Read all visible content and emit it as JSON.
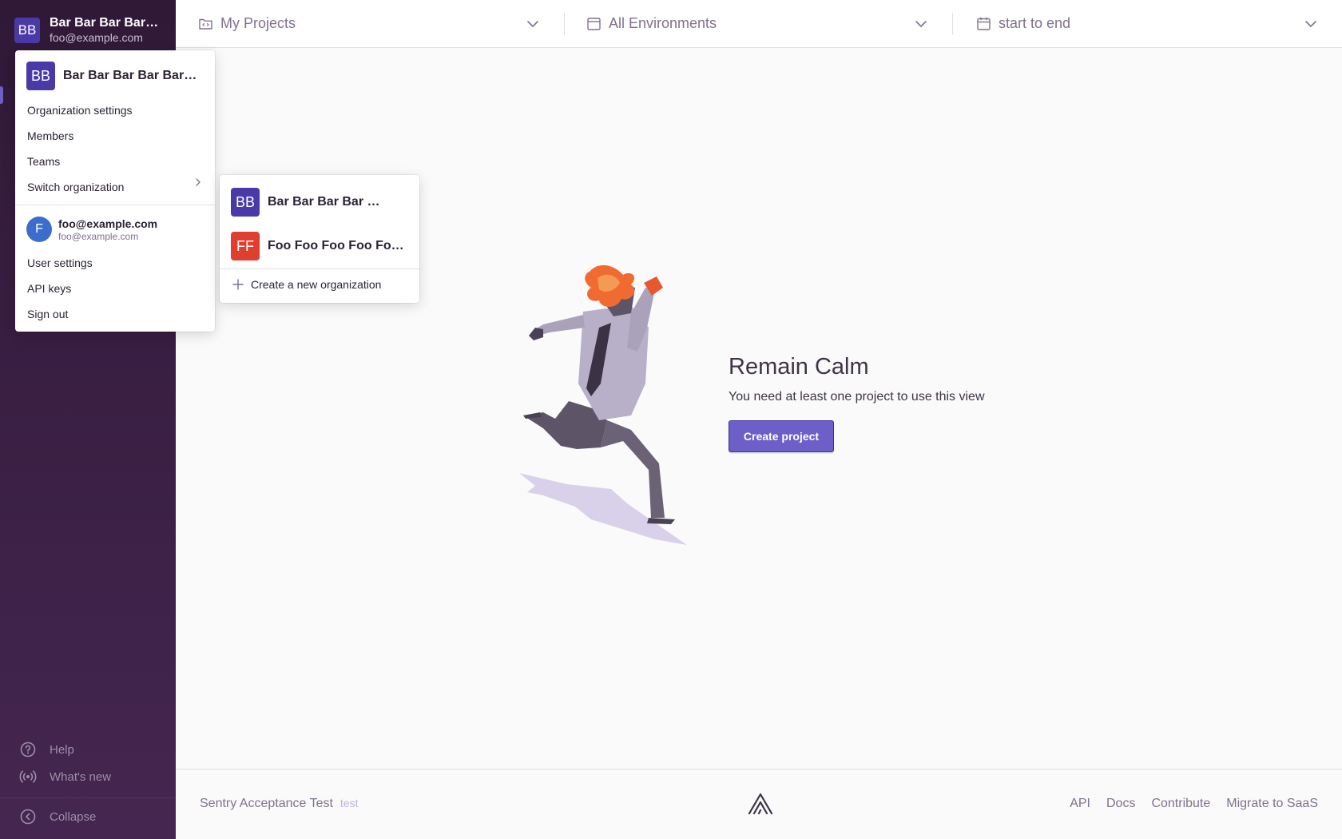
{
  "sidebar": {
    "org_initials": "BB",
    "org_name": "Bar Bar Bar Bar …",
    "org_email": "foo@example.com",
    "help_label": "Help",
    "whats_new_label": "What's new",
    "collapse_label": "Collapse"
  },
  "header": {
    "projects_label": "My Projects",
    "environments_label": "All Environments",
    "time_label": "start to end"
  },
  "empty_state": {
    "title": "Remain Calm",
    "subtitle": "You need at least one project to use this view",
    "button_label": "Create project"
  },
  "footer": {
    "app_name": "Sentry Acceptance Test",
    "version": "test",
    "links": [
      "API",
      "Docs",
      "Contribute",
      "Migrate to SaaS"
    ]
  },
  "org_menu": {
    "org_initials": "BB",
    "org_name": "Bar Bar Bar Bar Bar …",
    "items": [
      "Organization settings",
      "Members",
      "Teams",
      "Switch organization"
    ],
    "user_initial": "F",
    "user_name": "foo@example.com",
    "user_email": "foo@example.com",
    "user_items": [
      "User settings",
      "API keys",
      "Sign out"
    ]
  },
  "switch_menu": {
    "orgs": [
      {
        "initials": "BB",
        "name": "Bar Bar Bar Bar …",
        "color": "#4a3aa8"
      },
      {
        "initials": "FF",
        "name": "Foo Foo Foo Foo Foo …",
        "color": "#e03e2f"
      }
    ],
    "create_label": "Create a new organization"
  },
  "colors": {
    "accent": "#6c5fc7",
    "sidebar_top": "#2f1937",
    "sidebar_bottom": "#452650"
  }
}
